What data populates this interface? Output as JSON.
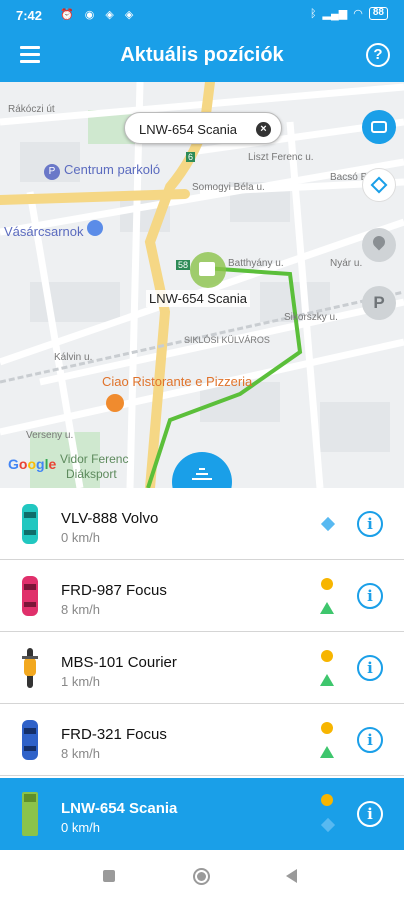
{
  "status_bar": {
    "time": "7:42",
    "battery": "88"
  },
  "app_bar": {
    "title": "Aktuális pozíciók"
  },
  "map": {
    "search_chip": {
      "value": "LNW-654 Scania"
    },
    "selected_marker_label": "LNW-654 Scania",
    "streets": [
      "Rákóczi út",
      "Liszt Ferenc u.",
      "Somogyi Béla u.",
      "Bacsó B.",
      "Batthyány u.",
      "Nyár u.",
      "Sikorszky u.",
      "Kálvin u.",
      "Verseny u.",
      "Vidor Ferenc"
    ],
    "districts": [
      "SIKLÓSI KÜLVÁROS"
    ],
    "pois": [
      "Centrum parkoló",
      "Vásárcsarnok",
      "Ciao Ristorante e Pizzeria",
      "Diáksport"
    ],
    "road_numbers": [
      "6",
      "58"
    ],
    "attribution": "Google",
    "colors": {
      "route": "#5bbf3a",
      "main_road": "#f5d785",
      "park": "#cfe8cf"
    }
  },
  "vehicles": [
    {
      "name": "VLV-888 Volvo",
      "speed": "0 km/h",
      "color": "#21c7c0",
      "icon": "car-icon",
      "statuses": [
        "blue-diamond"
      ],
      "selected": false
    },
    {
      "name": "FRD-987 Focus",
      "speed": "8 km/h",
      "color": "#e0306b",
      "icon": "car-icon",
      "statuses": [
        "yellow-dot",
        "green-triangle"
      ],
      "selected": false
    },
    {
      "name": "MBS-101 Courier",
      "speed": "1 km/h",
      "color": "#f2a81f",
      "icon": "motorcycle-icon",
      "statuses": [
        "yellow-dot",
        "green-triangle"
      ],
      "selected": false
    },
    {
      "name": "FRD-321 Focus",
      "speed": "8 km/h",
      "color": "#2f62c9",
      "icon": "car-icon",
      "statuses": [
        "yellow-dot",
        "green-triangle"
      ],
      "selected": false
    },
    {
      "name": "LNW-654 Scania",
      "speed": "0 km/h",
      "color": "#8bc34a",
      "icon": "truck-icon",
      "statuses": [
        "yellow-dot",
        "blue-diamond"
      ],
      "selected": true
    }
  ],
  "colors": {
    "accent": "#1a9fe8",
    "status_yellow": "#f7b500",
    "status_green": "#3ec66d",
    "status_blue": "#58b9f1"
  }
}
